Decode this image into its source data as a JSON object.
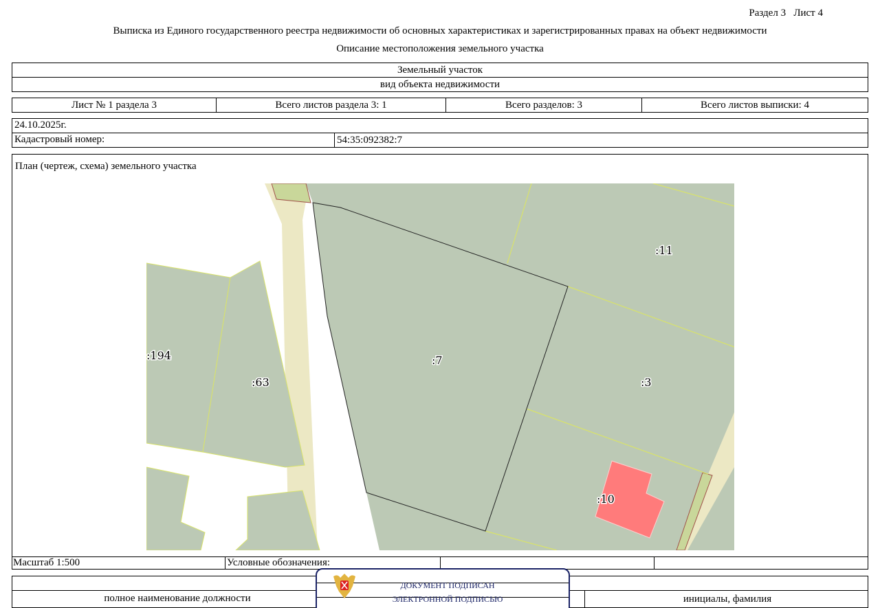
{
  "header": {
    "section": "Раздел 3",
    "sheet": "Лист 4",
    "title": "Выписка из Единого государственного реестра недвижимости об основных характеристиках и зарегистрированных правах на объект недвижимости",
    "subtitle": "Описание местоположения земельного участка"
  },
  "object": {
    "type": "Земельный участок",
    "type_caption": "вид объекта недвижимости"
  },
  "sheets": {
    "sheet_no": "Лист № 1 раздела 3",
    "total_section": "Всего листов раздела 3: 1",
    "total_sections": "Всего разделов: 3",
    "total_extract": "Всего листов выписки: 4"
  },
  "date": "24.10.2025г.",
  "cadastral": {
    "label": "Кадастровый номер:",
    "value": "54:35:092382:7"
  },
  "plan": {
    "title": "План (чертеж, схема) земельного участка",
    "parcels": [
      ":11",
      ":194",
      ":63",
      ":7",
      ":3",
      ":10"
    ]
  },
  "footer": {
    "scale": "Масштаб 1:500",
    "legend": "Условные обозначения:",
    "position": "полное наименование должности",
    "initials": "инициалы, фамилия"
  },
  "stamp": {
    "line1": "ДОКУМЕНТ ПОДПИСАН",
    "line2": "ЭЛЕКТРОННОЙ ПОДПИСЬЮ"
  },
  "colors": {
    "parcel": "#bcc9b5",
    "road": "#ece8c4",
    "building": "#ff7b7b",
    "boundary": "#d9e36a",
    "stamp": "#1a2366"
  }
}
